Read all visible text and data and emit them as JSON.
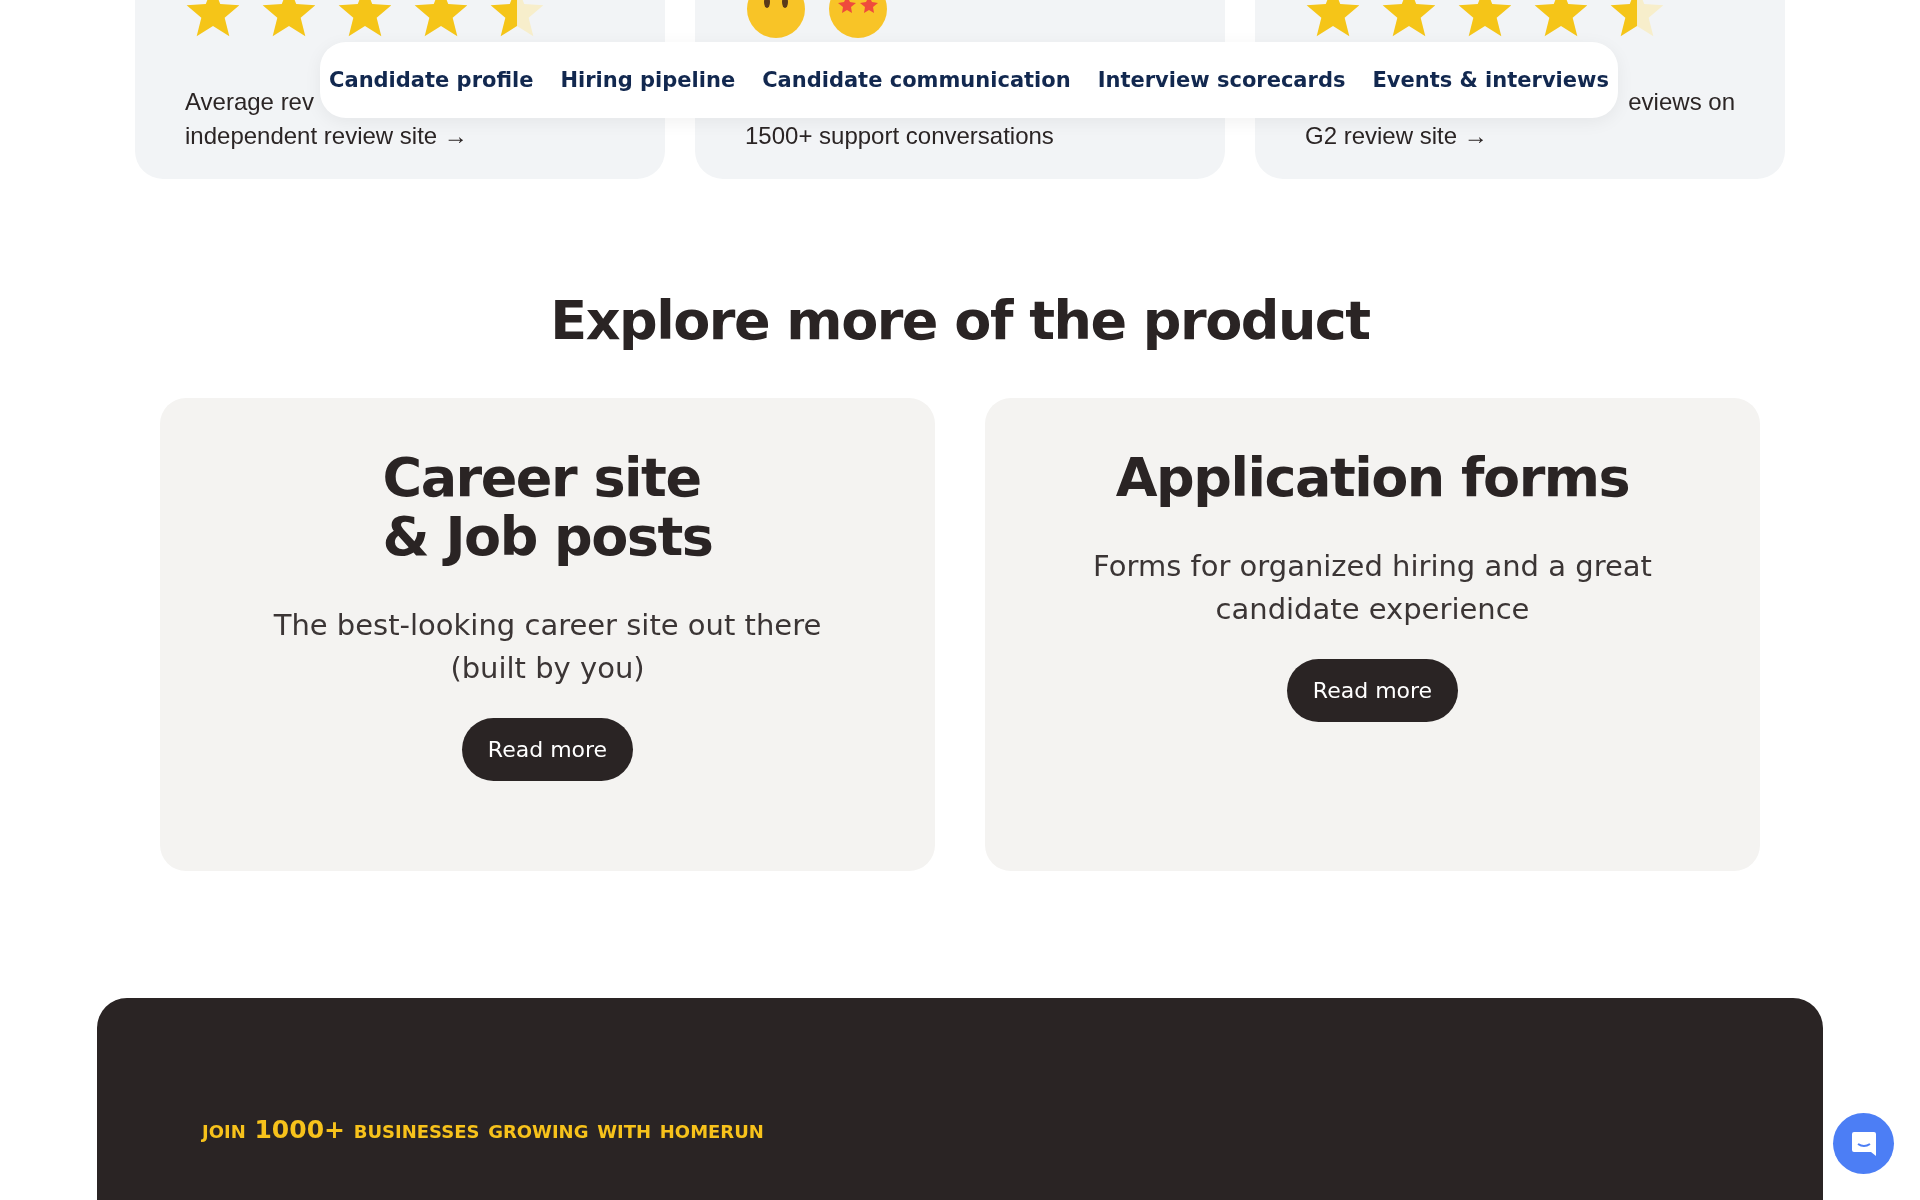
{
  "nav": {
    "tabs": [
      {
        "label": "Candidate profile",
        "selected": false
      },
      {
        "label": "Hiring pipeline",
        "selected": false
      },
      {
        "label": "Candidate communication",
        "selected": false
      },
      {
        "label": "Interview scorecards",
        "selected": false
      },
      {
        "label": "Events & interviews",
        "selected": false
      }
    ]
  },
  "reviews": [
    {
      "kind": "stars",
      "stars": 4.5,
      "line_start": "Average rev",
      "link": "independent review site →"
    },
    {
      "kind": "emoji",
      "link": "1500+ support conversations"
    },
    {
      "kind": "stars",
      "stars": 4.5,
      "line_end": "eviews on",
      "link": "G2 review site →"
    }
  ],
  "explore": {
    "title": "Explore more of the product",
    "cards": [
      {
        "title": "Career site\n& Job posts",
        "description": "The best-looking career site out there\n(built by you)",
        "button": "Read more"
      },
      {
        "title": "Application forms",
        "description": "Forms for organized hiring and a great\ncandidate experience",
        "button": "Read more"
      }
    ]
  },
  "banner": {
    "tagline": "join 1000+ businesses growing with homerun"
  }
}
